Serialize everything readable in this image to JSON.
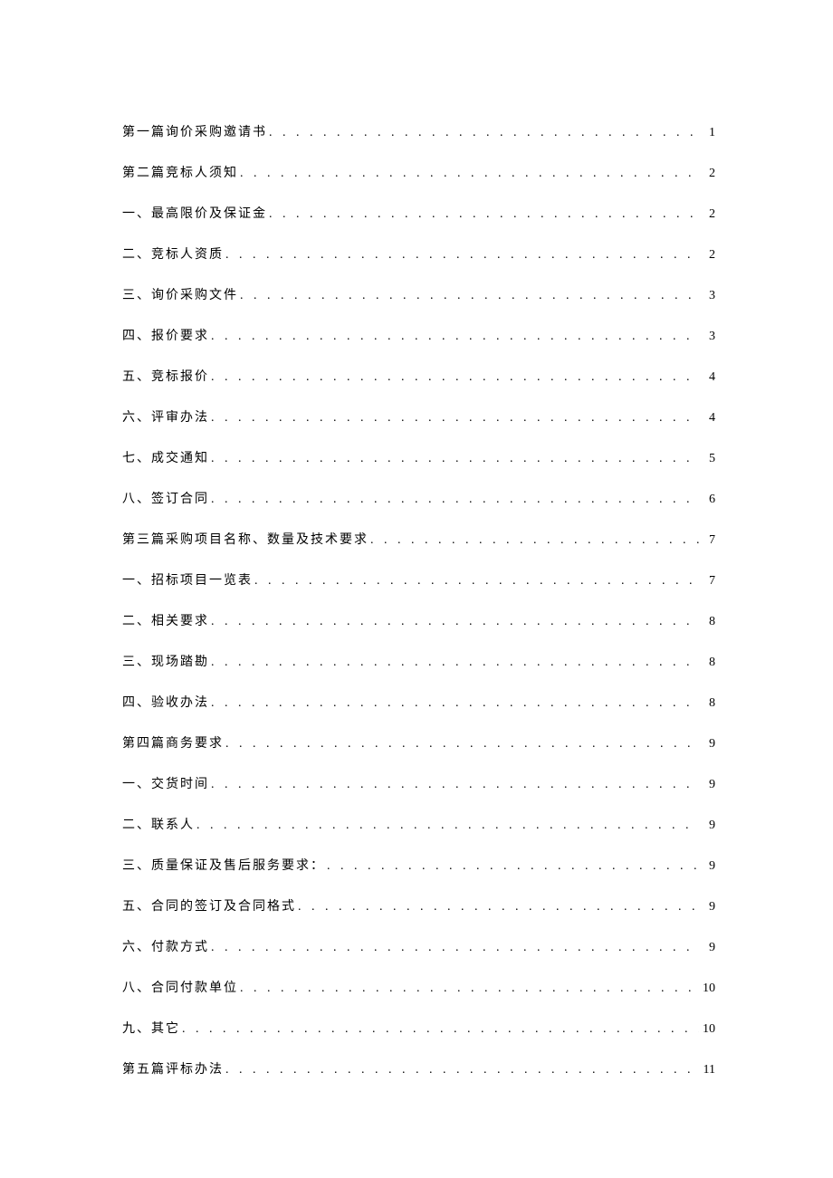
{
  "toc": {
    "entries": [
      {
        "title": "第一篇询价采购邀请书",
        "page": "1"
      },
      {
        "title": "第二篇竞标人须知",
        "page": "2"
      },
      {
        "title": "一、最高限价及保证金",
        "page": "2"
      },
      {
        "title": "二、竞标人资质",
        "page": "2"
      },
      {
        "title": "三、询价采购文件",
        "page": "3"
      },
      {
        "title": "四、报价要求",
        "page": "3"
      },
      {
        "title": "五、竞标报价",
        "page": "4"
      },
      {
        "title": "六、评审办法",
        "page": "4"
      },
      {
        "title": "七、成交通知",
        "page": "5"
      },
      {
        "title": "八、签订合同",
        "page": "6"
      },
      {
        "title": "第三篇采购项目名称、数量及技术要求",
        "page": "7"
      },
      {
        "title": "一、招标项目一览表",
        "page": "7"
      },
      {
        "title": "二、相关要求",
        "page": "8"
      },
      {
        "title": "三、现场踏勘",
        "page": "8"
      },
      {
        "title": "四、验收办法",
        "page": "8"
      },
      {
        "title": "第四篇商务要求",
        "page": "9"
      },
      {
        "title": "一、交货时间",
        "page": "9"
      },
      {
        "title": "二、联系人",
        "page": "9"
      },
      {
        "title": "三、质量保证及售后服务要求：",
        "page": "9"
      },
      {
        "title": "五、合同的签订及合同格式",
        "page": "9"
      },
      {
        "title": "六、付款方式",
        "page": "9"
      },
      {
        "title": "八、合同付款单位",
        "page": "10"
      },
      {
        "title": "九、其它",
        "page": "10"
      },
      {
        "title": "第五篇评标办法",
        "page": "11"
      }
    ]
  }
}
